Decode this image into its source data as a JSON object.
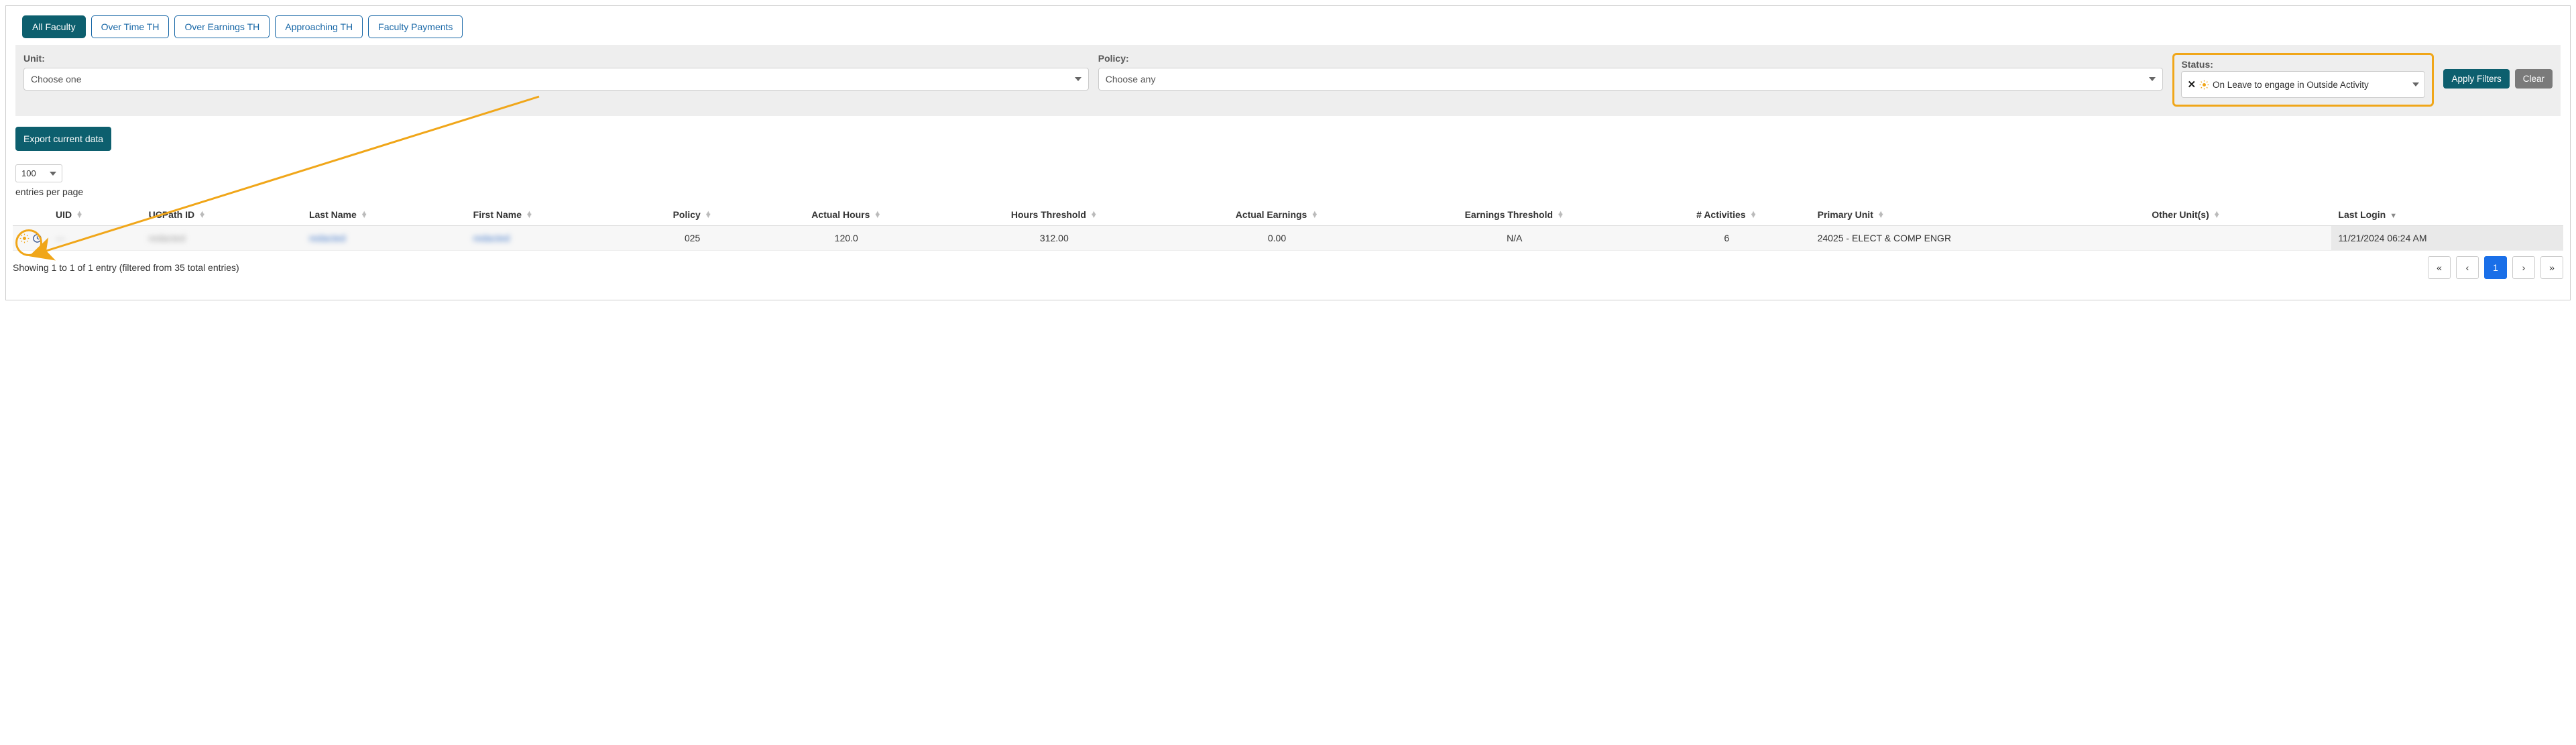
{
  "tabs": {
    "all_faculty": "All Faculty",
    "over_time_th": "Over Time TH",
    "over_earnings_th": "Over Earnings TH",
    "approaching_th": "Approaching TH",
    "faculty_payments": "Faculty Payments"
  },
  "filters": {
    "unit_label": "Unit:",
    "unit_placeholder": "Choose one",
    "policy_label": "Policy:",
    "policy_placeholder": "Choose any",
    "status_label": "Status:",
    "status_chip": "On Leave to engage in Outside Activity",
    "apply": "Apply Filters",
    "clear": "Clear"
  },
  "export_btn": "Export current data",
  "page_size": {
    "value": "100",
    "suffix": "entries per page"
  },
  "columns": {
    "status": "",
    "uid": "UID",
    "ucpath_id": "UCPath ID",
    "last_name": "Last Name",
    "first_name": "First Name",
    "policy": "Policy",
    "actual_hours": "Actual Hours",
    "hours_threshold": "Hours Threshold",
    "actual_earnings": "Actual Earnings",
    "earnings_threshold": "Earnings Threshold",
    "activities": "# Activities",
    "primary_unit": "Primary Unit",
    "other_units": "Other Unit(s)",
    "last_login": "Last Login"
  },
  "row": {
    "uid": "—",
    "ucpath_id": "redacted",
    "last_name": "redacted",
    "first_name": "redacted",
    "policy": "025",
    "actual_hours": "120.0",
    "hours_threshold": "312.00",
    "actual_earnings": "0.00",
    "earnings_threshold": "N/A",
    "activities": "6",
    "primary_unit": "24025 - ELECT & COMP ENGR",
    "other_units": "",
    "last_login": "11/21/2024 06:24 AM"
  },
  "footer": {
    "info": "Showing 1 to 1 of 1 entry (filtered from 35 total entries)",
    "first": "«",
    "prev": "‹",
    "page": "1",
    "next": "›",
    "last": "»"
  }
}
